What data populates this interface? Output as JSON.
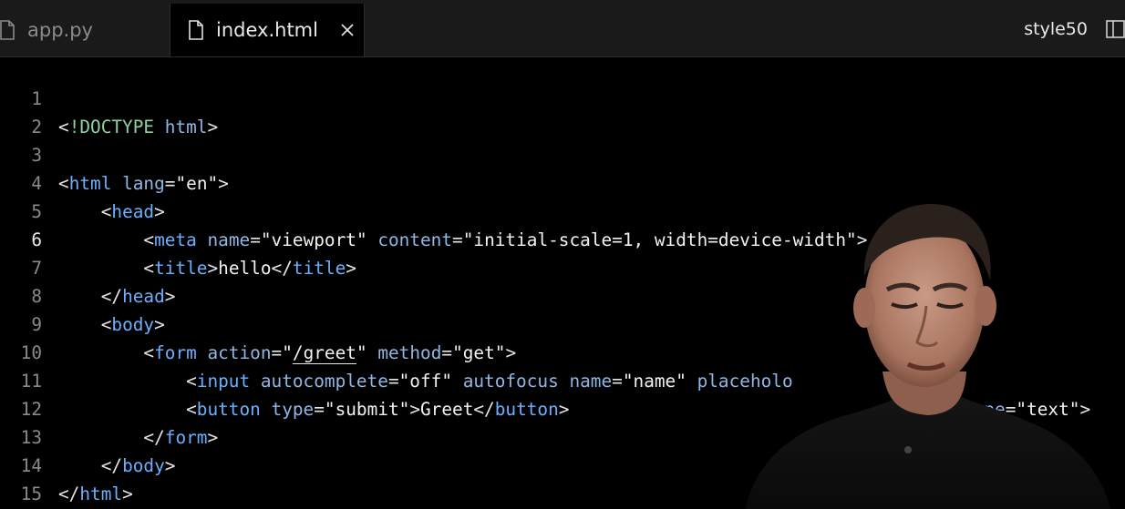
{
  "tabs": [
    {
      "label": "app.py",
      "active": false
    },
    {
      "label": "index.html",
      "active": true
    }
  ],
  "tab_close_glyph": "✕",
  "extension_label": "style50",
  "editor": {
    "active_line": 6,
    "lines": [
      {
        "n": "1"
      },
      {
        "n": "2"
      },
      {
        "n": "3"
      },
      {
        "n": "4"
      },
      {
        "n": "5"
      },
      {
        "n": "6"
      },
      {
        "n": "7"
      },
      {
        "n": "8"
      },
      {
        "n": "9"
      },
      {
        "n": "10"
      },
      {
        "n": "11"
      },
      {
        "n": "12"
      },
      {
        "n": "13"
      },
      {
        "n": "14"
      },
      {
        "n": "15"
      }
    ],
    "code_text": [
      "<!DOCTYPE html>",
      "",
      "<html lang=\"en\">",
      "    <head>",
      "        <meta name=\"viewport\" content=\"initial-scale=1, width=device-width\">",
      "        <title>hello</title>",
      "    </head>",
      "    <body>",
      "        <form action=\"/greet\" method=\"get\">",
      "            <input autocomplete=\"off\" autofocus name=\"name\" placeholo",
      "            <button type=\"submit\">Greet</button>",
      "        </form>",
      "    </body>",
      "</html>",
      ""
    ],
    "line10_tail": "type=\"text\">"
  },
  "colors": {
    "tag": "#6ab0ff",
    "attribute": "#8fb7e6",
    "string": "#f2f2f2",
    "background": "#000000",
    "tabbar": "#1a1a1b"
  }
}
